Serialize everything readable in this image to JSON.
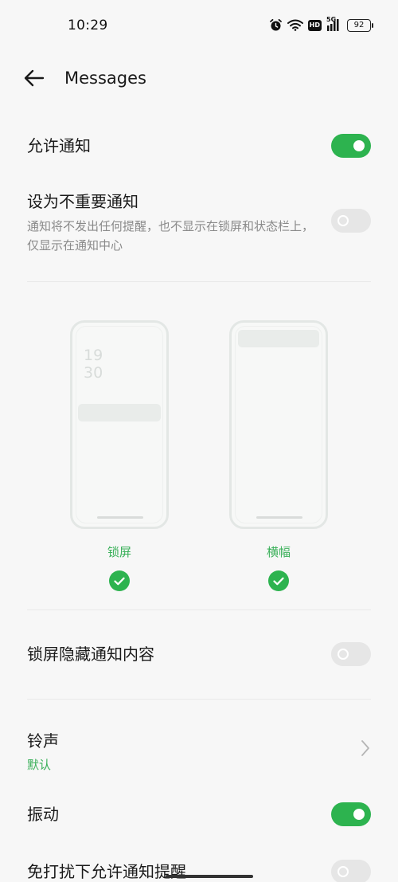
{
  "status_bar": {
    "time": "10:29",
    "network_label": "5G",
    "hd_label": "HD",
    "battery": "92"
  },
  "header": {
    "title": "Messages"
  },
  "settings": {
    "allow_notifications": {
      "label": "允许通知",
      "enabled": true
    },
    "unimportant": {
      "label": "设为不重要通知",
      "description": "通知将不发出任何提醒，也不显示在锁屏和状态栏上，仅显示在通知中心",
      "enabled": false
    },
    "previews": [
      {
        "label": "锁屏",
        "clock_hour": "19",
        "clock_minute": "30",
        "checked": true
      },
      {
        "label": "横幅",
        "checked": true
      }
    ],
    "hide_lockscreen_content": {
      "label": "锁屏隐藏通知内容",
      "enabled": false
    },
    "ringtone": {
      "label": "铃声",
      "value": "默认"
    },
    "vibration": {
      "label": "振动",
      "enabled": true
    },
    "dnd_allow": {
      "label": "免打扰下允许通知提醒",
      "enabled": false
    }
  },
  "colors": {
    "accent": "#2db34f",
    "accent_text": "#3bb05a",
    "background": "#f7f7f7",
    "toggle_off": "#e6e6e6"
  },
  "icons": [
    "alarm-icon",
    "wifi-icon",
    "hd-icon",
    "signal-5g-icon",
    "battery-icon",
    "back-arrow-icon",
    "check-icon",
    "chevron-right-icon"
  ]
}
